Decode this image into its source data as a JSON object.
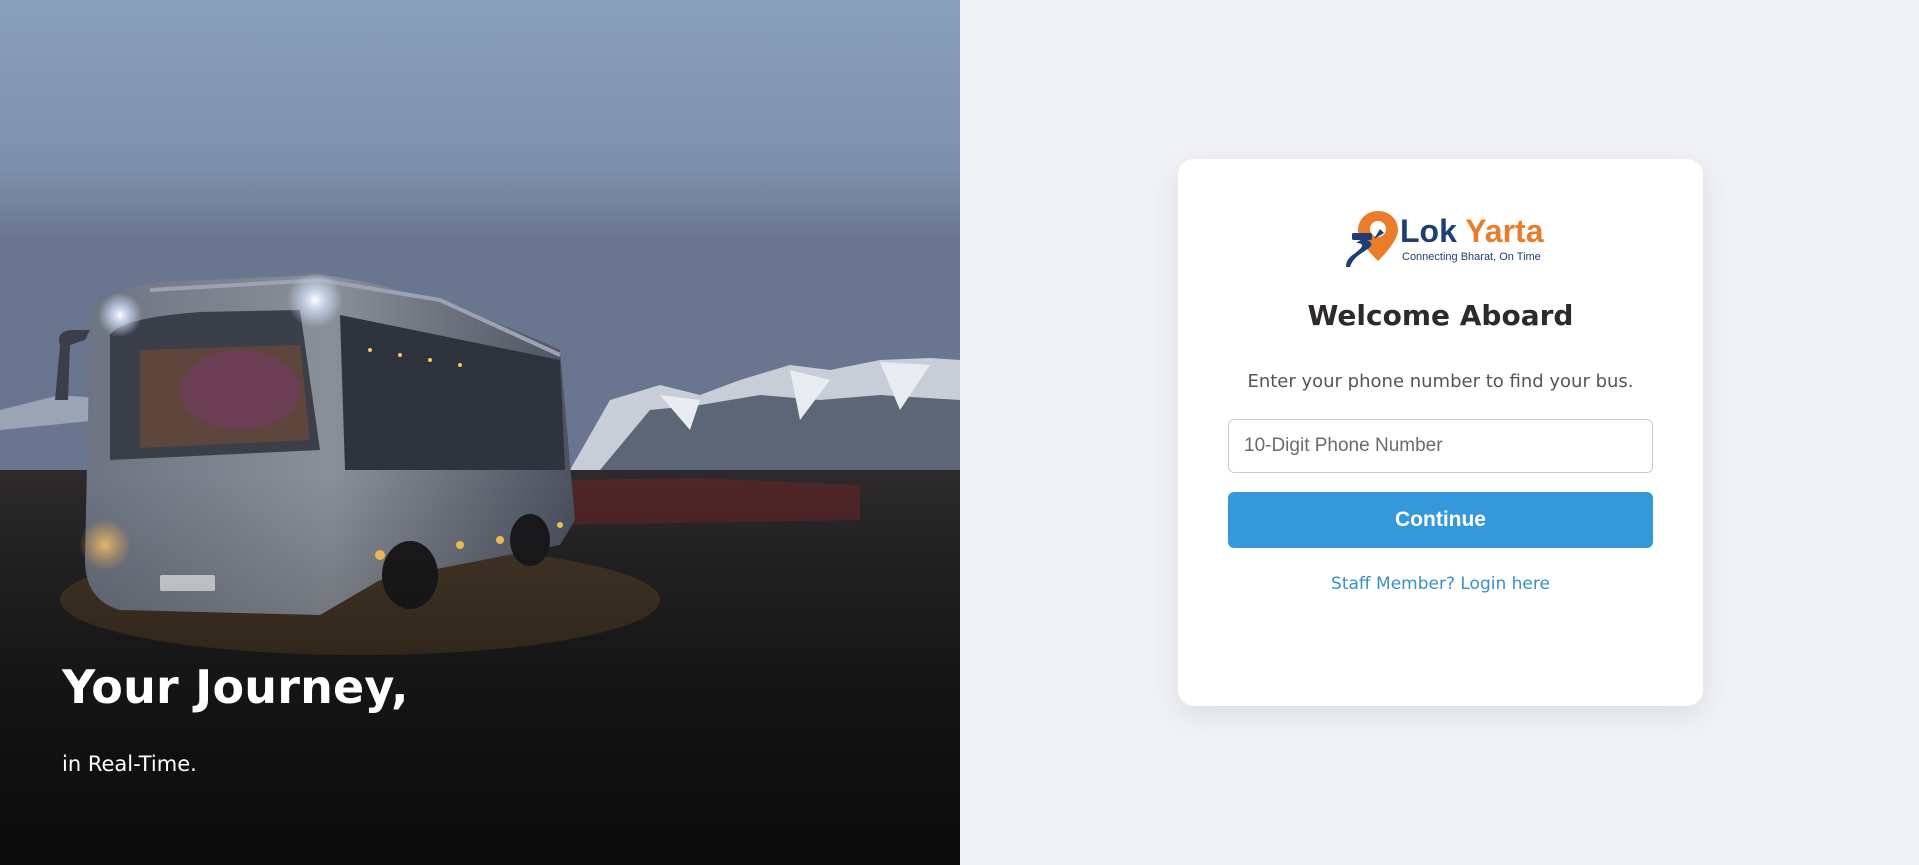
{
  "hero": {
    "image_description_icon": "bus-at-dusk-photo",
    "title": "Your Journey,",
    "subtitle": "in Real-Time."
  },
  "brand": {
    "name_part1": "Lok",
    "name_part2": "Yarta",
    "tagline": "Connecting Bharat, On Time",
    "primary_color": "#1f3f73",
    "accent_color": "#ea7d2c"
  },
  "login": {
    "heading": "Welcome Aboard",
    "instruction": "Enter your phone number to find your bus.",
    "phone_placeholder": "10-Digit Phone Number",
    "phone_value": "",
    "continue_label": "Continue",
    "staff_link": "Staff Member? Login here",
    "button_color": "#3498db",
    "link_color": "#3a8fc4"
  }
}
